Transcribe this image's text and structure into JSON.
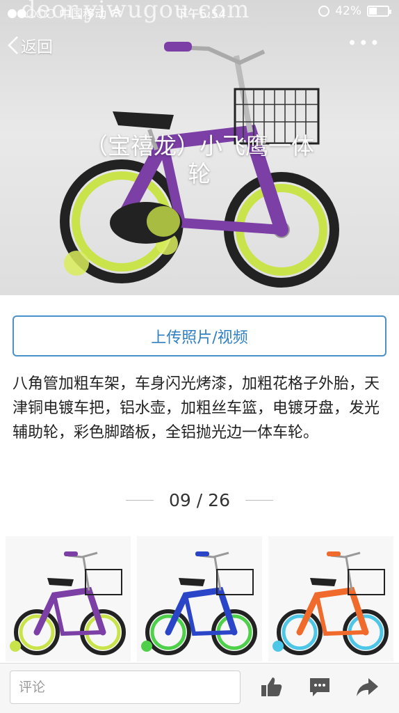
{
  "watermark": "deor.yiwugou.com",
  "status_bar": {
    "carrier": "中国移动",
    "time": "下午5:54",
    "battery": "42%",
    "battery_level": 0.42
  },
  "nav": {
    "back_label": "返回",
    "more_label": "•••"
  },
  "hero": {
    "title": "（宝禧龙）小飞鹰一体轮"
  },
  "upload_button": "上传照片/视频",
  "description": "八角管加粗车架，车身闪光烤漆，加粗花格子外胎，天津铜电镀车把，铝水壶，加粗丝车篮，电镀牙盘，发光辅助轮，彩色脚踏板，全铝抛光边一体车轮。",
  "pager": {
    "current": "09",
    "separator": "/",
    "total": "26"
  },
  "thumbnails": [
    {
      "name": "purple-bike",
      "frame": "#7b3fa6",
      "wheel": "#c9e34a"
    },
    {
      "name": "blue-bike",
      "frame": "#2a45c8",
      "wheel": "#4fd04a"
    },
    {
      "name": "orange-bike",
      "frame": "#f06a2c",
      "wheel": "#4ec6e8"
    }
  ],
  "bottom_bar": {
    "comment_placeholder": "评论",
    "icons": [
      "thumbs-up-icon",
      "comment-icon",
      "share-icon"
    ]
  }
}
